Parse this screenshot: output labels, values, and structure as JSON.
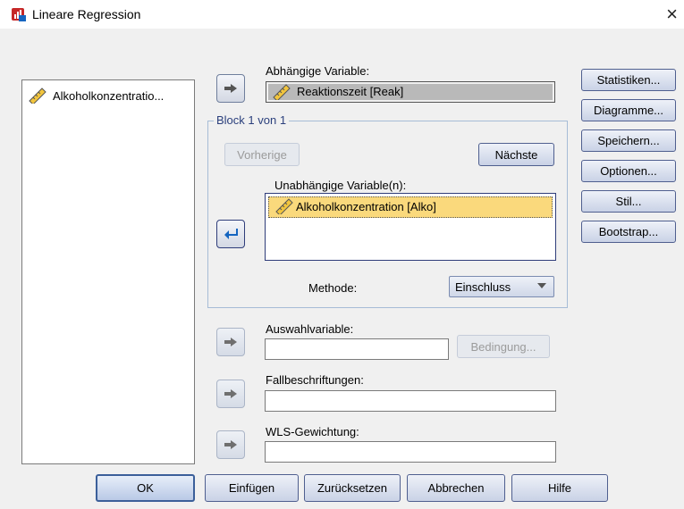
{
  "window": {
    "title": "Lineare Regression",
    "close": "×"
  },
  "source_list": {
    "items": [
      {
        "label": "Alkoholkonzentratio..."
      }
    ]
  },
  "dependent": {
    "label": "Abhängige Variable:",
    "value": "Reaktionszeit [Reak]"
  },
  "block": {
    "legend": "Block 1 von 1",
    "prev_label": "Vorherige",
    "next_label": "Nächste",
    "independent_label": "Unabhängige Variable(n):",
    "independent_items": [
      {
        "label": "Alkoholkonzentration [Alko]"
      }
    ],
    "method_label": "Methode:",
    "method_value": "Einschluss"
  },
  "selection": {
    "label": "Auswahlvariable:",
    "value": "",
    "condition_label": "Bedingung..."
  },
  "case_labels": {
    "label": "Fallbeschriftungen:",
    "value": ""
  },
  "wls": {
    "label": "WLS-Gewichtung:",
    "value": ""
  },
  "side_buttons": [
    "Statistiken...",
    "Diagramme...",
    "Speichern...",
    "Optionen...",
    "Stil...",
    "Bootstrap..."
  ],
  "bottom_buttons": {
    "ok": "OK",
    "paste": "Einfügen",
    "reset": "Zurücksetzen",
    "cancel": "Abbrechen",
    "help": "Hilfe"
  },
  "colors": {
    "window_bg": "#f0f0f0",
    "selection_highlight": "#fad97c",
    "dependent_field_bg": "#b9b9b9",
    "accent_blue": "#2f3d7a"
  },
  "icons": {
    "app": "spss-regression-icon",
    "variable": "ruler-scale-icon",
    "move_right": "arrow-right-icon",
    "move_left": "arrow-left-icon"
  }
}
